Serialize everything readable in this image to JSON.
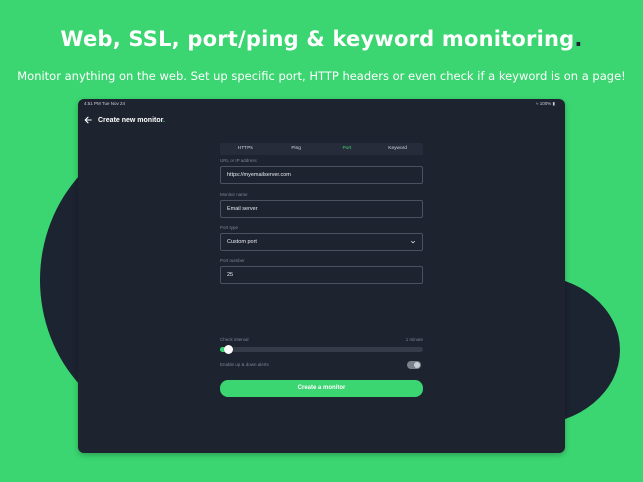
{
  "hero": {
    "headline": "Web, SSL, port/ping & keyword monitoring",
    "headline_dot": ".",
    "subline": "Monitor anything on the web. Set up specific port, HTTP headers or even check if a keyword is on a page!"
  },
  "statusbar": {
    "time": "4:51 PM   Tue Nov 24",
    "battery": "100%"
  },
  "nav": {
    "title": "Create new monitor",
    "title_dot": "."
  },
  "tabs": [
    {
      "label": "HTTPs",
      "active": false
    },
    {
      "label": "Ping",
      "active": false
    },
    {
      "label": "Port",
      "active": true
    },
    {
      "label": "Keyword",
      "active": false
    }
  ],
  "form": {
    "url_label": "URL or IP address",
    "url_value": "https://myemailserver.com",
    "name_label": "Monitor name",
    "name_value": "Email server",
    "port_type_label": "Port type",
    "port_type_value": "Custom port",
    "port_number_label": "Port number",
    "port_number_value": "25",
    "interval_label": "Check interval",
    "interval_value": "1 minute",
    "interval_fraction": 0.04,
    "alerts_label": "Enable up & down alerts",
    "alerts_enabled": false,
    "submit_label": "Create a monitor"
  },
  "colors": {
    "accent": "#3bd671",
    "panel": "#1e2330",
    "background": "#3bd671"
  }
}
